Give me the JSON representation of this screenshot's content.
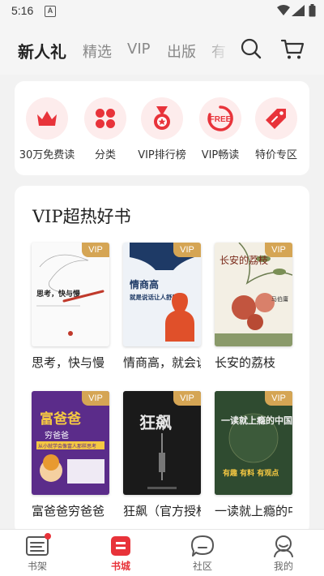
{
  "status": {
    "time": "5:16",
    "notification_icon": "A"
  },
  "top_nav": {
    "tabs": [
      {
        "label": "新人礼",
        "active": true
      },
      {
        "label": "精选",
        "active": false
      },
      {
        "label": "VIP",
        "active": false
      },
      {
        "label": "出版",
        "active": false
      },
      {
        "label": "有",
        "active": false
      }
    ],
    "search_icon": "search-icon",
    "cart_icon": "cart-icon"
  },
  "quick_entries": [
    {
      "label": "30万免费读",
      "icon": "crown-icon"
    },
    {
      "label": "分类",
      "icon": "grid-icon"
    },
    {
      "label": "VIP排行榜",
      "icon": "medal-icon"
    },
    {
      "label": "VIP畅读",
      "icon": "free-badge-icon",
      "icon_text": "FREE"
    },
    {
      "label": "特价专区",
      "icon": "price-tag-icon"
    }
  ],
  "section": {
    "title": "VIP超热好书",
    "badge": "VIP",
    "books": [
      {
        "title": "思考，快与慢",
        "cover_text": "思考，快与慢"
      },
      {
        "title": "情商高，就会说话",
        "cover_text": "情商高",
        "cover_sub": "就是说话让人舒服"
      },
      {
        "title": "长安的荔枝",
        "cover_text": "长安的荔枝",
        "cover_author": "马伯庸"
      },
      {
        "title": "富爸爸穷爸爸",
        "cover_text": "富爸爸",
        "cover_sub": "穷爸爸",
        "cover_sub2": "从小就学会像富人那样思考"
      },
      {
        "title": "狂飙（官方授权版）",
        "cover_text": "狂飙"
      },
      {
        "title": "一读就上瘾的中国史",
        "cover_text": "一读就上瘾的中国史",
        "cover_sub": "有趣 有料 有观点"
      }
    ]
  },
  "bottom_nav": [
    {
      "label": "书架",
      "icon": "bookshelf-icon",
      "active": false,
      "dot": true
    },
    {
      "label": "书城",
      "icon": "bookstore-icon",
      "active": true,
      "dot": false
    },
    {
      "label": "社区",
      "icon": "chat-bubble-icon",
      "active": false,
      "dot": false
    },
    {
      "label": "我的",
      "icon": "profile-icon",
      "active": false,
      "dot": false
    }
  ],
  "colors": {
    "accent": "#e8333a",
    "vip_gold": "#d5a554",
    "icon_bg": "#fdecec"
  }
}
